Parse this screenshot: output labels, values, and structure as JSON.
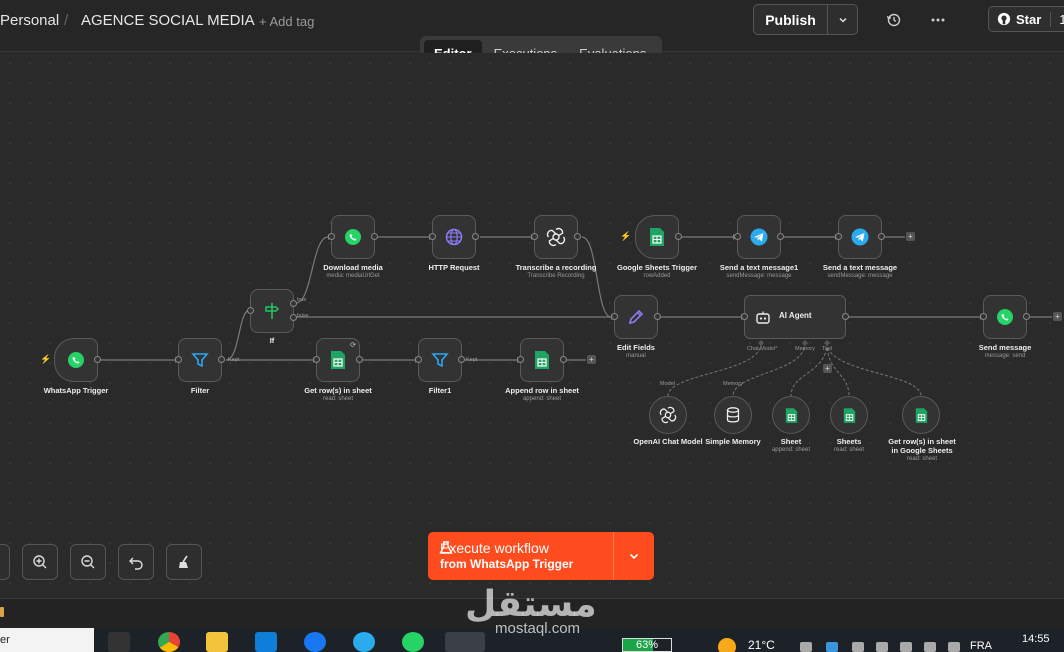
{
  "header": {
    "breadcrumb_project": "Personal",
    "breadcrumb_sep": "/",
    "workflow_name": "AGENCE SOCIAL MEDIA",
    "add_tag": "+ Add tag",
    "publish_label": "Publish",
    "star_label": "Star",
    "star_count": "1"
  },
  "tabs": [
    {
      "label": "Editor",
      "active": true
    },
    {
      "label": "Executions",
      "active": false
    },
    {
      "label": "Evaluations",
      "active": false
    }
  ],
  "nodes": {
    "whatsapp_trigger": {
      "label": "WhatsApp Trigger",
      "icon": "whatsapp-icon",
      "color": "#25d366"
    },
    "filter": {
      "label": "Filter",
      "icon": "funnel-icon",
      "color": "#2aa8f5"
    },
    "if": {
      "label": "If",
      "icon": "signpost-icon",
      "color": "#22c55e",
      "out_true": "true",
      "out_false": "false"
    },
    "download_media": {
      "label": "Download media",
      "sub": "media: mediaUrlGet"
    },
    "http_request": {
      "label": "HTTP Request",
      "icon": "globe-icon",
      "color": "#8b7cf6"
    },
    "transcribe": {
      "label": "Transcribe a recording",
      "sub": "Transcribe Recording",
      "icon": "openai-icon"
    },
    "get_rows": {
      "label": "Get row(s) in sheet",
      "sub": "read: sheet"
    },
    "filter1": {
      "label": "Filter1",
      "kept": "Kept"
    },
    "append_row": {
      "label": "Append row in sheet",
      "sub": "append: sheet"
    },
    "sheets_trigger": {
      "label": "Google Sheets Trigger",
      "sub": "rowAdded"
    },
    "send_text_1": {
      "label": "Send a text message1",
      "sub": "sendMessage: message",
      "icon": "telegram-icon"
    },
    "send_text_2": {
      "label": "Send a text message",
      "sub": "sendMessage: message",
      "icon": "telegram-icon"
    },
    "edit_fields": {
      "label": "Edit Fields",
      "sub": "manual",
      "icon": "pencil-icon",
      "color": "#8b7cf6"
    },
    "ai_agent": {
      "label": "AI Agent",
      "icon": "robot-icon",
      "conn_chat": "Chat Model*",
      "conn_memory": "Memory",
      "conn_tool": "Tool"
    },
    "send_message": {
      "label": "Send message",
      "sub": "message: send"
    },
    "openai_chat": {
      "label": "OpenAI Chat Model",
      "caption": "Model"
    },
    "simple_memory": {
      "label": "Simple Memory",
      "caption": "Memory"
    },
    "sheet_tool": {
      "label": "Sheet",
      "sub": "append: sheet"
    },
    "sheets_tool": {
      "label": "Sheets",
      "sub": "read: sheet"
    },
    "get_rows_tool": {
      "label": "Get row(s) in sheet in Google Sheets",
      "sub": "read: sheet"
    }
  },
  "execute": {
    "line1": "Execute workflow",
    "line2": "from WhatsApp Trigger"
  },
  "taskbar": {
    "search": "er",
    "battery": "63%",
    "weather": "21°C",
    "lang": "FRA",
    "time": "14:55"
  },
  "watermark": {
    "arabic": "مستقل",
    "url": "mostaql.com"
  },
  "colors": {
    "accent": "#ff4c1f",
    "whatsapp": "#25d366",
    "sheets": "#1fa463",
    "telegram": "#2aabee"
  }
}
